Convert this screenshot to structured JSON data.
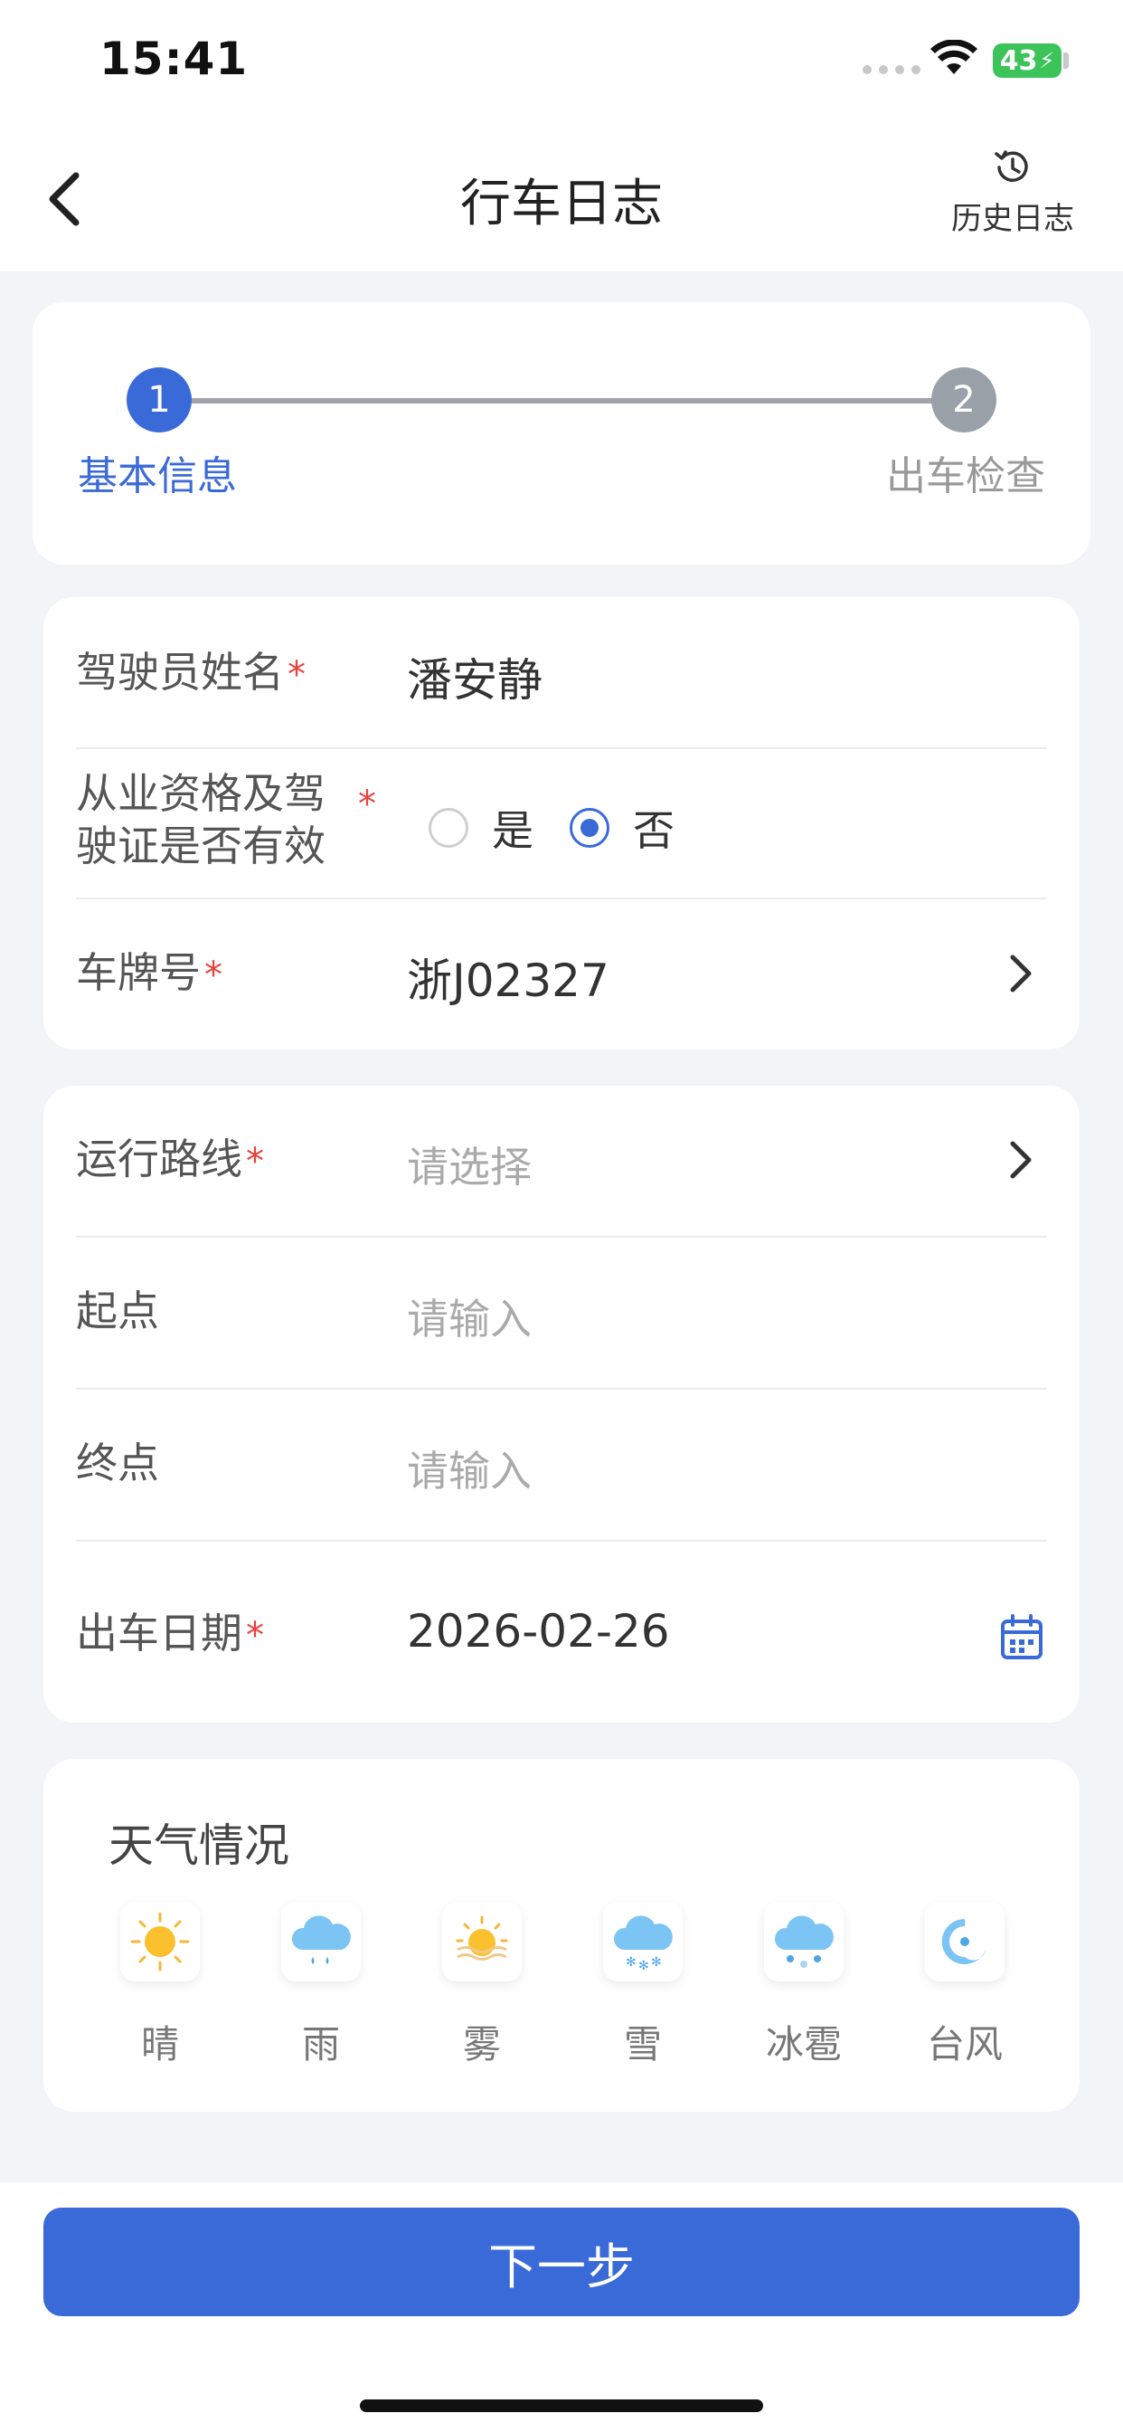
{
  "status": {
    "time": "15:41",
    "battery": "43"
  },
  "nav": {
    "title": "行车日志",
    "history_label": "历史日志"
  },
  "steps": [
    {
      "number": "1",
      "label": "基本信息"
    },
    {
      "number": "2",
      "label": "出车检查"
    }
  ],
  "driver": {
    "name_label": "驾驶员姓名",
    "name_value": "潘安静",
    "qual_label_line1": "从业资格及驾",
    "qual_label_line2": "驶证是否有效",
    "qual_yes": "是",
    "qual_no": "否",
    "qual_selected": "否",
    "plate_label": "车牌号",
    "plate_value": "浙J02327",
    "required_mark": "*"
  },
  "route": {
    "route_label": "运行路线",
    "route_placeholder": "请选择",
    "start_label": "起点",
    "start_placeholder": "请输入",
    "end_label": "终点",
    "end_placeholder": "请输入",
    "date_label": "出车日期",
    "date_value": "2026-02-26"
  },
  "weather": {
    "title": "天气情况",
    "items": [
      {
        "label": "晴",
        "icon": "sun-icon"
      },
      {
        "label": "雨",
        "icon": "rain-icon"
      },
      {
        "label": "雾",
        "icon": "fog-icon"
      },
      {
        "label": "雪",
        "icon": "snow-icon"
      },
      {
        "label": "冰雹",
        "icon": "hail-icon"
      },
      {
        "label": "台风",
        "icon": "typhoon-icon"
      }
    ]
  },
  "footer": {
    "next_label": "下一步"
  },
  "colors": {
    "accent": "#3a6ad8",
    "required": "#e8413c",
    "battery": "#3cc45a"
  }
}
